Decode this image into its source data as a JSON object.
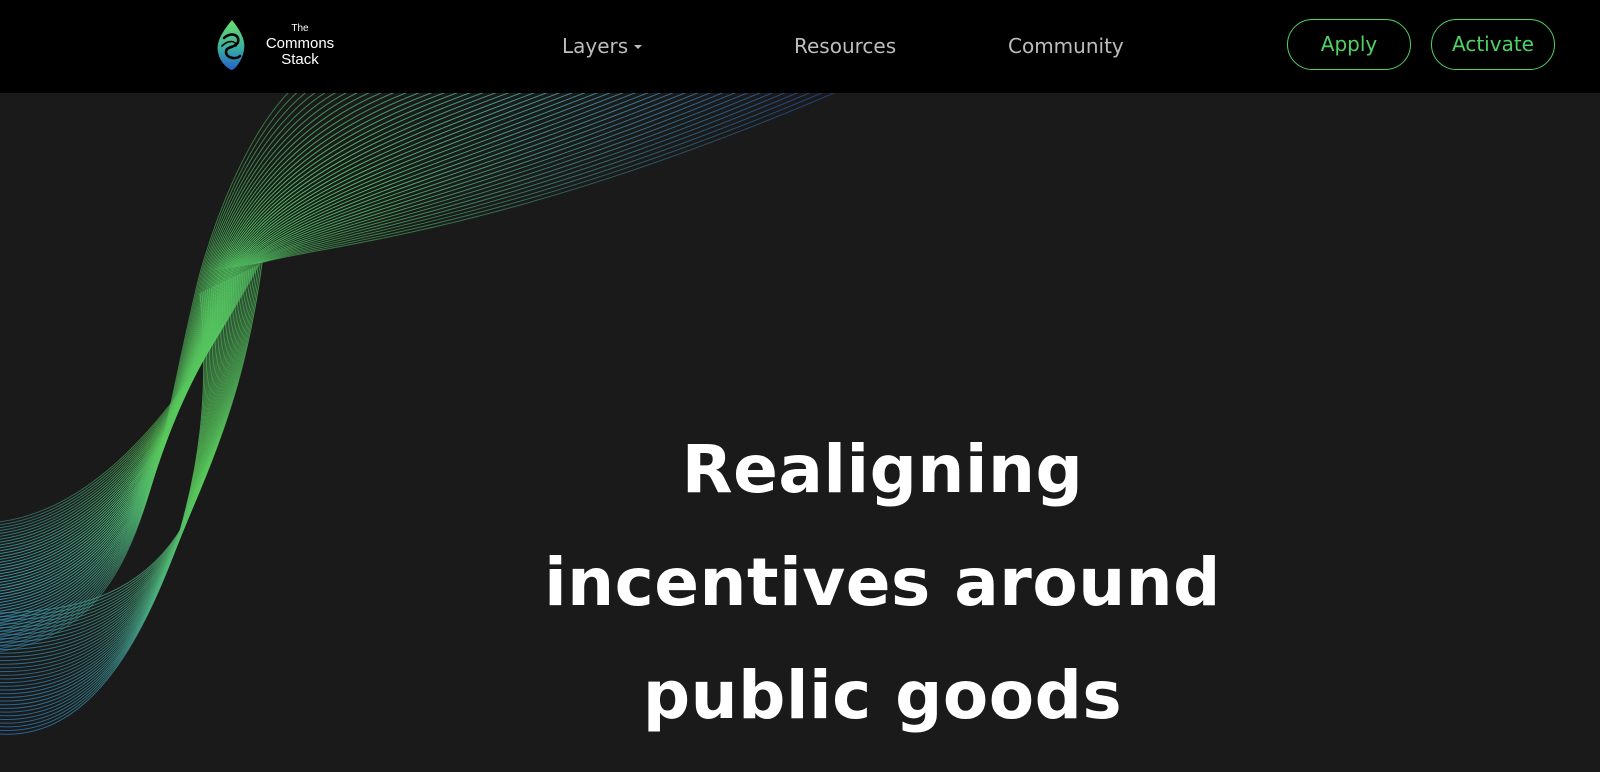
{
  "header": {
    "logo": {
      "line1": "The",
      "line2": "Commons",
      "line3": "Stack",
      "icon": "flame-logo-icon"
    },
    "nav": {
      "layers": "Layers",
      "resources": "Resources",
      "community": "Community"
    },
    "buttons": {
      "apply": "Apply",
      "activate": "Activate"
    }
  },
  "hero": {
    "title": "Realigning incentives around public goods"
  },
  "colors": {
    "accent": "#4fd163",
    "background": "#1a1a1a",
    "navbar": "#000000",
    "wave_green": "#58c95a",
    "wave_blue": "#2a78d8"
  }
}
